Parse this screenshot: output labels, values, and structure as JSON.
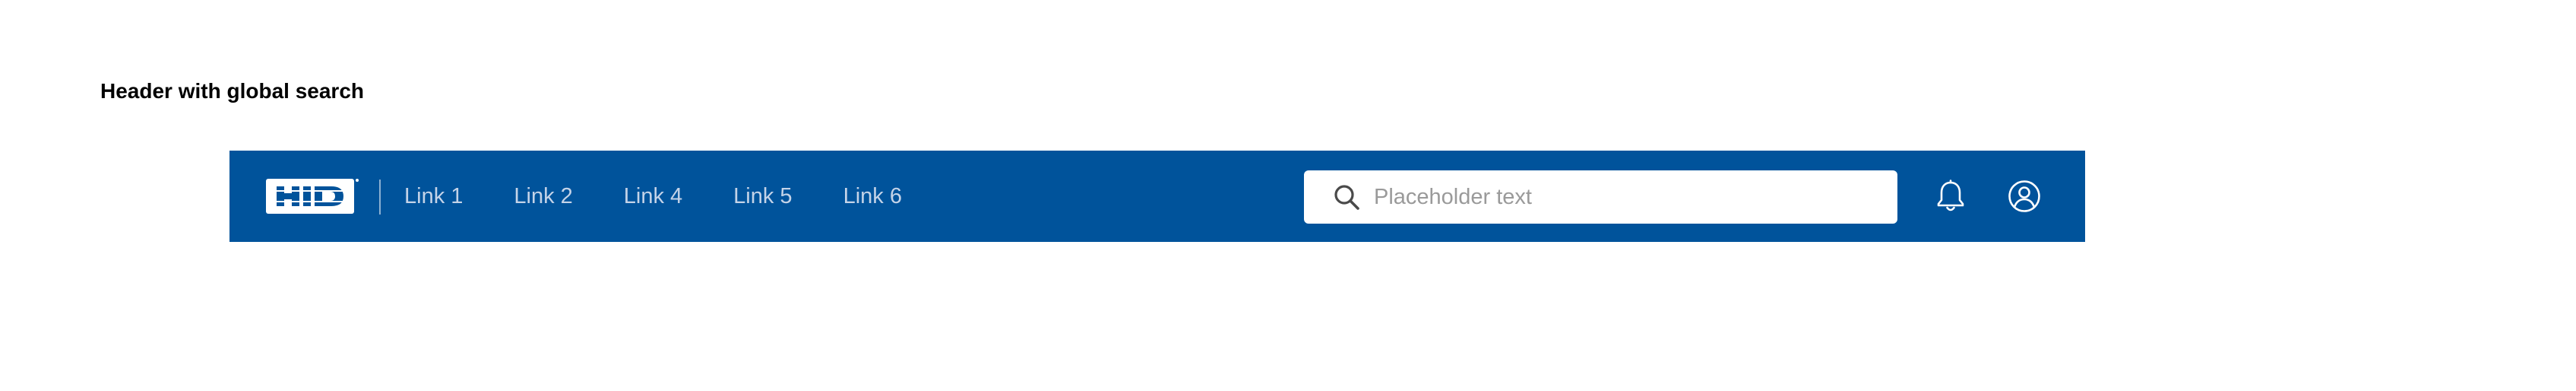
{
  "section": {
    "title": "Header with global search"
  },
  "header": {
    "background_color": "#00539b",
    "logo": {
      "text": "HID",
      "icon": "hid-logo"
    },
    "nav_links": [
      {
        "label": "Link 1"
      },
      {
        "label": "Link 2"
      },
      {
        "label": "Link 4"
      },
      {
        "label": "Link 5"
      },
      {
        "label": "Link 6"
      }
    ],
    "search": {
      "placeholder": "Placeholder text",
      "value": "",
      "icon": "search-icon"
    },
    "actions": {
      "notifications_icon": "bell-icon",
      "account_icon": "user-circle-icon"
    }
  }
}
